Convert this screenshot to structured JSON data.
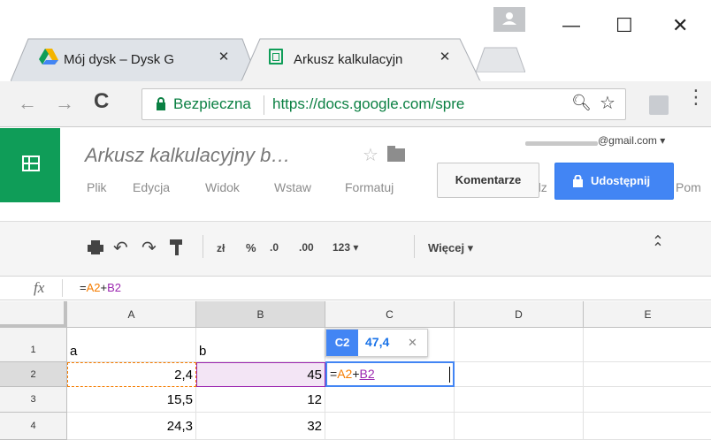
{
  "browser": {
    "tabs": [
      {
        "label": "Mój dysk – Dysk G",
        "close": "✕",
        "active": false
      },
      {
        "label": "Arkusz kalkulacyjn",
        "close": "✕",
        "active": true
      }
    ],
    "address": {
      "secure_label": "Bezpieczna",
      "url": "https://docs.google.com/spre"
    },
    "icons": [
      "back-arrow-icon",
      "forward-arrow-icon",
      "reload-icon",
      "lock-icon",
      "zoom-icon",
      "star-icon",
      "extension-icon",
      "more-icon",
      "user-icon"
    ]
  },
  "window": {
    "minimize": "—",
    "maximize": "☐",
    "close": "✕"
  },
  "app": {
    "doc_title": "Arkusz kalkulacyjny b…",
    "account": "@gmail.com ▾",
    "menu": [
      "Plik",
      "Edycja",
      "Widok",
      "Wstaw",
      "Formatuj"
    ],
    "menu_overflow_left": "dz",
    "menu_overflow_right": "Pom",
    "comments_button": "Komentarze",
    "share_button": "Udostępnij",
    "accent": "#0f9d58",
    "share_color": "#4285f4"
  },
  "toolbar": {
    "currency": "zł",
    "percent": "%",
    "dec_decrease": ".0",
    "dec_increase": ".00",
    "format_more": "123 ▾",
    "more": "Więcej ▾",
    "collapse": "⌃⌃"
  },
  "formula_bar": {
    "fx": "fx",
    "formula_prefix": "=",
    "ref1": "A2",
    "plus": "+",
    "ref2": "B2"
  },
  "grid": {
    "columns": [
      "A",
      "B",
      "C",
      "D",
      "E"
    ],
    "rows": [
      {
        "n": "1",
        "a": "a",
        "b": "b"
      },
      {
        "n": "2",
        "a": "2,4",
        "b": "45"
      },
      {
        "n": "3",
        "a": "15,5",
        "b": "12"
      },
      {
        "n": "4",
        "a": "24,3",
        "b": "32"
      }
    ],
    "tooltip": {
      "ref": "C2",
      "value": "47,4",
      "close": "✕"
    },
    "editor": {
      "prefix": "=",
      "ref1": "A2",
      "plus": "+",
      "ref2": "B2"
    }
  }
}
